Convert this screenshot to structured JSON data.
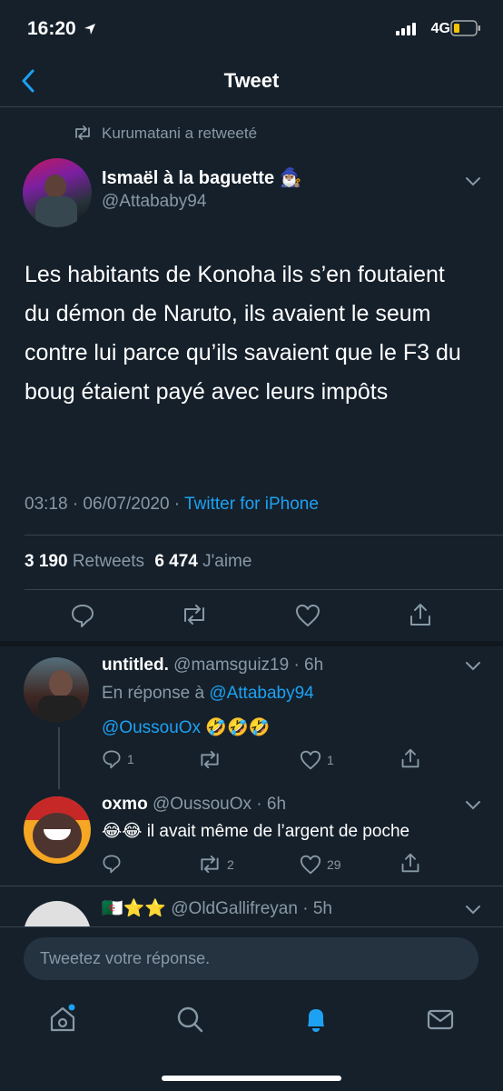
{
  "status_bar": {
    "time": "16:20",
    "network": "4G"
  },
  "nav": {
    "title": "Tweet"
  },
  "tweet": {
    "retweet_context": "Kurumatani a retweeté",
    "author_name": "Ismaël à la baguette",
    "author_emoji": "🧙🏽‍♂️",
    "handle": "@Attababy94",
    "text": "Les habitants de Konoha ils s’en foutaient du démon de Naruto, ils avaient le seum contre lui parce qu’ils savaient que le F3 du boug étaient payé avec leurs impôts",
    "timestamp": "03:18 · 06/07/2020 · ",
    "source": "Twitter for iPhone",
    "retweets_count": "3 190",
    "retweets_label": "Retweets",
    "likes_count": "6 474",
    "likes_label": "J'aime"
  },
  "replies": [
    {
      "name": "untitled.",
      "meta": "@mamsguiz19 · 6h",
      "reply_prefix": "En réponse à ",
      "reply_to": "@Attababy94",
      "mention": "@OussouOx",
      "emojis": "🤣🤣🤣",
      "reply_count": "1",
      "retweet_count": "",
      "like_count": "1"
    },
    {
      "name": "oxmo",
      "meta": "@OussouOx · 6h",
      "emojis": "😂😂",
      "text": "il avait même de l’argent de poche",
      "reply_count": "",
      "retweet_count": "2",
      "like_count": "29"
    },
    {
      "name": "🇩🇿⭐⭐",
      "meta": "@OldGallifreyan · 5h"
    }
  ],
  "composer": {
    "placeholder": "Tweetez votre réponse."
  },
  "colors": {
    "background": "#15202b",
    "accent": "#1da1f2",
    "muted": "#8899a6",
    "divider": "#38444d"
  },
  "icons": [
    "location-arrow-icon",
    "signal-icon",
    "battery-icon",
    "back-chevron-icon",
    "retweet-icon",
    "chevron-down-icon",
    "reply-icon",
    "like-icon",
    "share-icon",
    "home-icon",
    "search-icon",
    "notifications-icon",
    "messages-icon"
  ]
}
